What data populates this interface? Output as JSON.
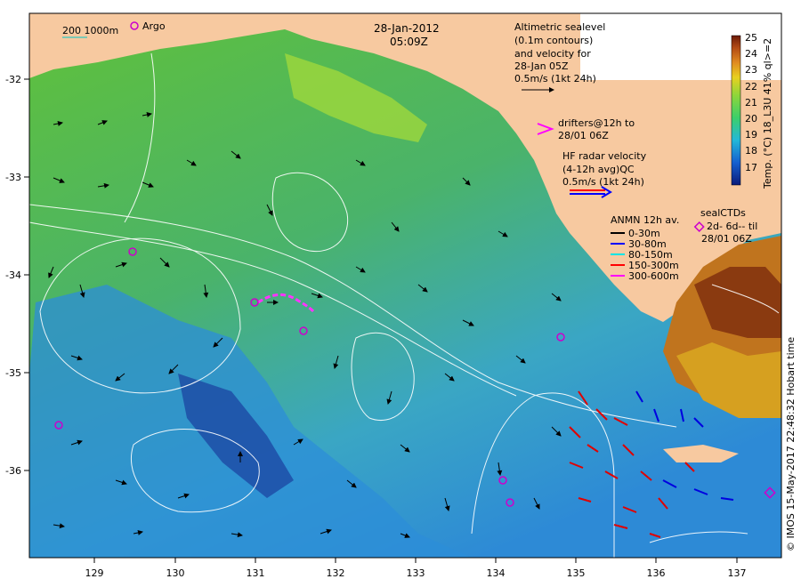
{
  "title": {
    "date": "28-Jan-2012",
    "time": "05:09Z"
  },
  "scale_bar": {
    "label": "200 1000m"
  },
  "argo": {
    "label": "Argo",
    "color": "#cc00cc"
  },
  "altimetry": {
    "lines": [
      "Altimetric sealevel",
      "(0.1m contours)",
      "and velocity for",
      "28-Jan 05Z",
      "0.5m/s (1kt 24h)"
    ]
  },
  "drifters": {
    "lines": [
      "drifters@12h to",
      "28/01 06Z"
    ],
    "color": "#ff00ff"
  },
  "hf_radar": {
    "lines": [
      "HF radar velocity",
      "(4-12h avg)QC",
      "0.5m/s (1kt 24h)"
    ],
    "colors": [
      "#ff0000",
      "#0000ff"
    ]
  },
  "anmn": {
    "title": "ANMN 12h av.",
    "items": [
      {
        "label": "0-30m",
        "color": "#000000"
      },
      {
        "label": "30-80m",
        "color": "#0000ff"
      },
      {
        "label": "80-150m",
        "color": "#00e5e5"
      },
      {
        "label": "150-300m",
        "color": "#ff0000"
      },
      {
        "label": "300-600m",
        "color": "#ff00ff"
      }
    ]
  },
  "sealctd": {
    "lines": [
      "sealCTDs",
      "2d- 6d-- til",
      "28/01 06Z"
    ],
    "color": "#cc00cc"
  },
  "colorbar": {
    "label": "Temp. (°C) 18_L3U 41% ql>=2",
    "ticks": [
      "25",
      "24",
      "23",
      "22",
      "21",
      "20",
      "19",
      "18",
      "17"
    ]
  },
  "credit": "© IMOS 15-May-2017 22:48:32 Hobart time",
  "axes": {
    "x_ticks": [
      "129",
      "130",
      "131",
      "132",
      "133",
      "134",
      "135",
      "136",
      "137"
    ],
    "y_ticks": [
      "-32",
      "-33",
      "-34",
      "-35",
      "-36"
    ]
  }
}
